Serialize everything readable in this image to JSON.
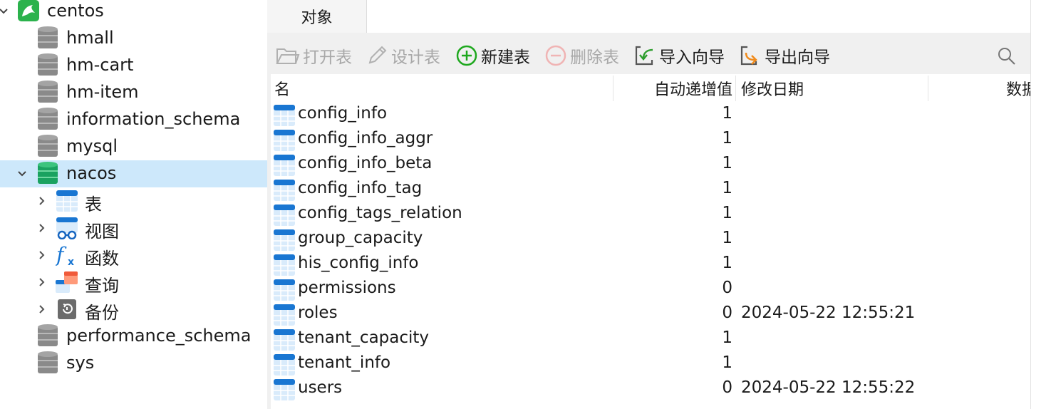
{
  "tree": {
    "connection": "centos",
    "databases_before": [
      "hmall",
      "hm-cart",
      "hm-item",
      "information_schema",
      "mysql"
    ],
    "selected_db": "nacos",
    "children": [
      "表",
      "视图",
      "函数",
      "查询",
      "备份"
    ],
    "databases_after": [
      "performance_schema",
      "sys"
    ]
  },
  "tabs": {
    "objects": "对象"
  },
  "toolbar": {
    "open_table": "打开表",
    "design_table": "设计表",
    "new_table": "新建表",
    "delete_table": "删除表",
    "import_wizard": "导入向导",
    "export_wizard": "导出向导"
  },
  "grid": {
    "columns": [
      "名",
      "自动递增值",
      "修改日期",
      "数据"
    ],
    "rows": [
      {
        "name": "config_info",
        "auto_increment": "1",
        "modified": ""
      },
      {
        "name": "config_info_aggr",
        "auto_increment": "1",
        "modified": ""
      },
      {
        "name": "config_info_beta",
        "auto_increment": "1",
        "modified": ""
      },
      {
        "name": "config_info_tag",
        "auto_increment": "1",
        "modified": ""
      },
      {
        "name": "config_tags_relation",
        "auto_increment": "1",
        "modified": ""
      },
      {
        "name": "group_capacity",
        "auto_increment": "1",
        "modified": ""
      },
      {
        "name": "his_config_info",
        "auto_increment": "1",
        "modified": ""
      },
      {
        "name": "permissions",
        "auto_increment": "0",
        "modified": ""
      },
      {
        "name": "roles",
        "auto_increment": "0",
        "modified": "2024-05-22 12:55:21"
      },
      {
        "name": "tenant_capacity",
        "auto_increment": "1",
        "modified": ""
      },
      {
        "name": "tenant_info",
        "auto_increment": "1",
        "modified": ""
      },
      {
        "name": "users",
        "auto_increment": "0",
        "modified": "2024-05-22 12:55:22"
      }
    ]
  },
  "icons": {
    "connection": "mysql-dolphin-icon",
    "database": "database-icon",
    "table": "table-icon",
    "search": "search-icon"
  },
  "colors": {
    "selection": "#cde8fb",
    "db_gray": "#8a8a8a",
    "db_green": "#1aa260",
    "table_blue": "#1976d2",
    "new_green": "#1ea81e"
  }
}
